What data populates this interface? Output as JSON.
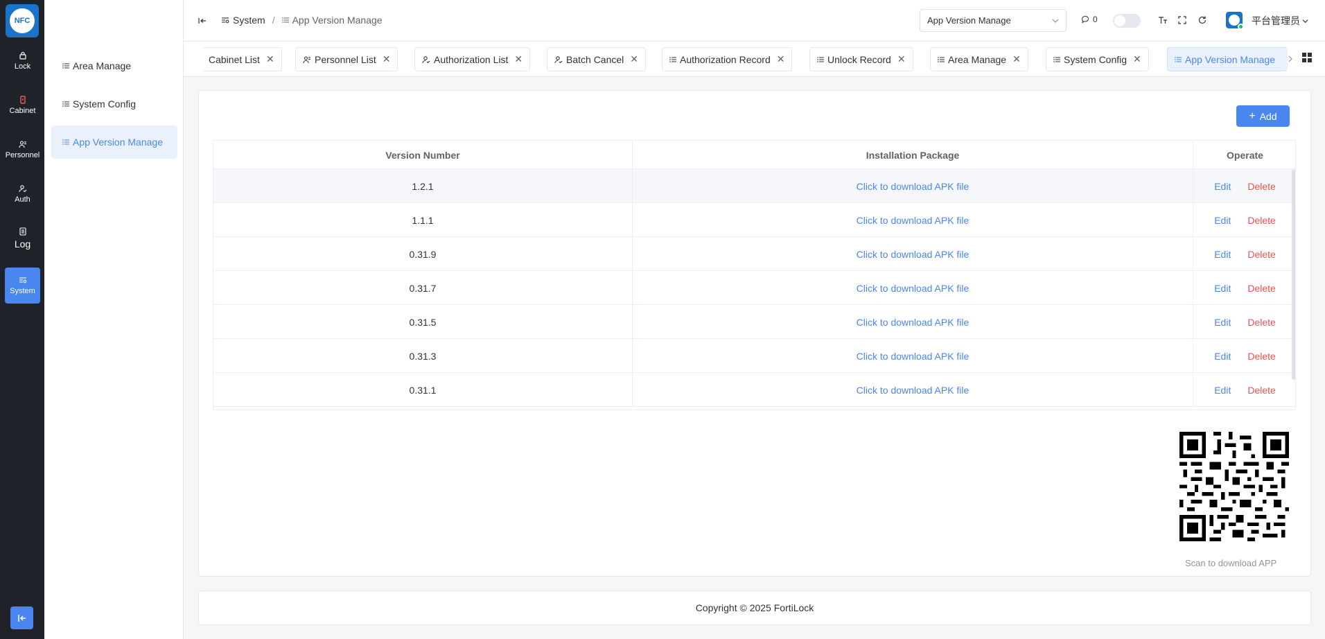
{
  "app": {
    "logo_text": "NFC",
    "brand_color": "#4a86f0"
  },
  "rail": {
    "items": [
      {
        "label": "Lock",
        "icon": "lock-icon"
      },
      {
        "label": "Cabinet",
        "icon": "cabinet-icon"
      },
      {
        "label": "Personnel",
        "icon": "personnel-icon"
      },
      {
        "label": "Auth",
        "icon": "auth-icon"
      },
      {
        "label": "Log",
        "icon": "log-icon"
      },
      {
        "label": "System",
        "icon": "system-icon"
      }
    ]
  },
  "submenu": {
    "items": [
      {
        "label": "Area Manage"
      },
      {
        "label": "System Config"
      },
      {
        "label": "App Version Manage"
      }
    ]
  },
  "header": {
    "breadcrumb": {
      "root": "System",
      "current": "App Version Manage"
    },
    "select_value": "App Version Manage",
    "notification_count": "0",
    "user_name": "平台管理员"
  },
  "tabs": [
    {
      "label": "Cabinet List"
    },
    {
      "label": "Personnel List"
    },
    {
      "label": "Authorization List"
    },
    {
      "label": "Batch Cancel"
    },
    {
      "label": "Authorization Record"
    },
    {
      "label": "Unlock Record"
    },
    {
      "label": "Area Manage"
    },
    {
      "label": "System Config"
    },
    {
      "label": "App Version Manage"
    }
  ],
  "toolbar": {
    "add_label": "Add"
  },
  "table": {
    "columns": [
      "Version Number",
      "Installation Package",
      "Operate"
    ],
    "rows": [
      {
        "version": "1.2.1",
        "package": "Click to download APK file",
        "edit": "Edit",
        "delete": "Delete"
      },
      {
        "version": "1.1.1",
        "package": "Click to download APK file",
        "edit": "Edit",
        "delete": "Delete"
      },
      {
        "version": "0.31.9",
        "package": "Click to download APK file",
        "edit": "Edit",
        "delete": "Delete"
      },
      {
        "version": "0.31.7",
        "package": "Click to download APK file",
        "edit": "Edit",
        "delete": "Delete"
      },
      {
        "version": "0.31.5",
        "package": "Click to download APK file",
        "edit": "Edit",
        "delete": "Delete"
      },
      {
        "version": "0.31.3",
        "package": "Click to download APK file",
        "edit": "Edit",
        "delete": "Delete"
      },
      {
        "version": "0.31.1",
        "package": "Click to download APK file",
        "edit": "Edit",
        "delete": "Delete"
      }
    ]
  },
  "qr": {
    "caption": "Scan to download APP"
  },
  "footer": {
    "copyright": "Copyright © 2025 FortiLock"
  }
}
